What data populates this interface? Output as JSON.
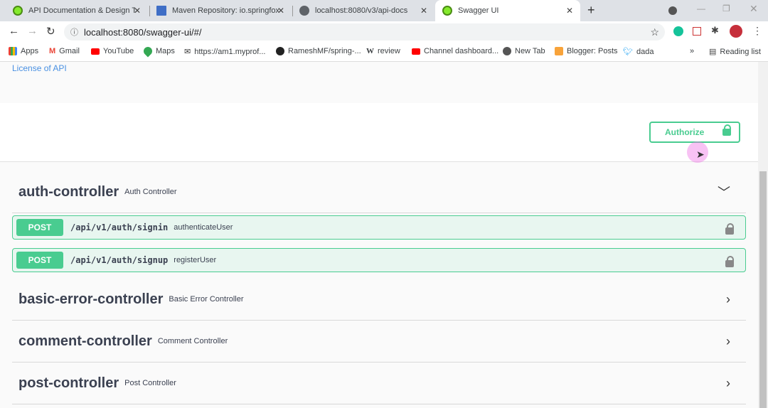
{
  "tabs": [
    {
      "title": "API Documentation & Design To",
      "favicon_color": "#85ea2d"
    },
    {
      "title": "Maven Repository: io.springfox »",
      "favicon_color": "#3f6ec6"
    },
    {
      "title": "localhost:8080/v3/api-docs",
      "favicon_color": "#5f6368"
    },
    {
      "title": "Swagger UI",
      "favicon_color": "#85ea2d",
      "active": true
    }
  ],
  "new_tab": "+",
  "address": "localhost:8080/swagger-ui/#/",
  "bookmarks": [
    {
      "label": "Apps",
      "icon": "apps-grid-icon"
    },
    {
      "label": "Gmail",
      "icon": "gmail-icon"
    },
    {
      "label": "YouTube",
      "icon": "youtube-icon"
    },
    {
      "label": "Maps",
      "icon": "maps-icon"
    },
    {
      "label": "https://am1.myprof...",
      "icon": "mail-icon"
    },
    {
      "label": "RameshMF/spring-...",
      "icon": "github-icon"
    },
    {
      "label": "review",
      "icon": "wikipedia-icon"
    },
    {
      "label": "Channel dashboard...",
      "icon": "youtube-icon"
    },
    {
      "label": "New Tab",
      "icon": "globe-icon"
    },
    {
      "label": "Blogger: Posts",
      "icon": "blogger-icon"
    },
    {
      "label": "dada",
      "icon": "twitter-icon"
    }
  ],
  "reading_list": "Reading list",
  "license_link": "License of API",
  "authorize_label": "Authorize",
  "accent": "#49cc90",
  "controllers": [
    {
      "name": "auth-controller",
      "desc": "Auth Controller",
      "expanded": true,
      "ops": [
        {
          "method": "POST",
          "path": "/api/v1/auth/signin",
          "summary": "authenticateUser"
        },
        {
          "method": "POST",
          "path": "/api/v1/auth/signup",
          "summary": "registerUser"
        }
      ]
    },
    {
      "name": "basic-error-controller",
      "desc": "Basic Error Controller",
      "expanded": false
    },
    {
      "name": "comment-controller",
      "desc": "Comment Controller",
      "expanded": false
    },
    {
      "name": "post-controller",
      "desc": "Post Controller",
      "expanded": false
    }
  ]
}
